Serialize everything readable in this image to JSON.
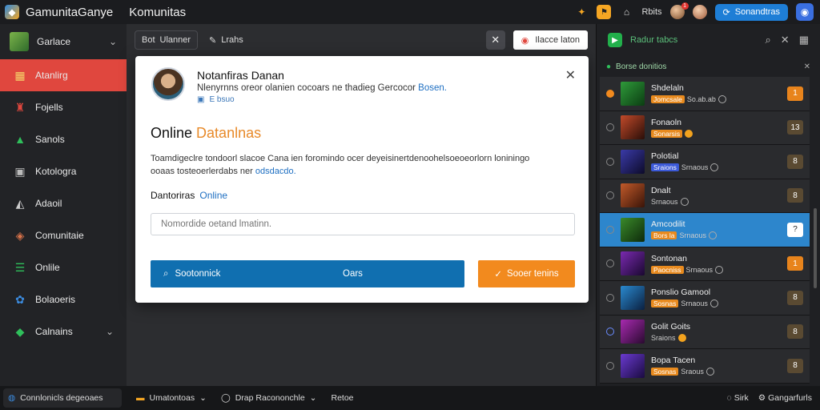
{
  "app": {
    "title": "GamunitaGanye",
    "subtitle": "Komunitas",
    "top_label": "Rbits",
    "notif_count": "1",
    "action_button": "Sonandtras"
  },
  "sidebar": {
    "header_label": "Garlace",
    "items": [
      {
        "label": "Atanlirg",
        "icon": "chart-icon",
        "color": "#f5a623"
      },
      {
        "label": "Fojells",
        "icon": "fire-icon",
        "color": "#e0473e"
      },
      {
        "label": "Sanols",
        "icon": "growth-icon",
        "color": "#2fbf5b"
      },
      {
        "label": "Kotologra",
        "icon": "box-icon",
        "color": "#bbbbbb"
      },
      {
        "label": "Adaoil",
        "icon": "pyramid-icon",
        "color": "#cccccc"
      },
      {
        "label": "Comunitaie",
        "icon": "community-icon",
        "color": "#d9734a"
      },
      {
        "label": "Onlile",
        "icon": "list-icon",
        "color": "#2fbf5b"
      },
      {
        "label": "Bolaoeris",
        "icon": "gear-icon",
        "color": "#3c8ce0"
      },
      {
        "label": "Calnains",
        "icon": "ticket-icon",
        "color": "#2fbf5b"
      }
    ]
  },
  "toolbar": {
    "btn1_label": "Ulanner",
    "btn1_prefix": "Bot",
    "btn2_label": "Lrahs",
    "right_button": "Ilacce laton"
  },
  "modal": {
    "name": "Notanfiras Danan",
    "description": "Nlenyrnns oreor olanien cocoars ne thadieg Gercocor",
    "description_link": "Bosen.",
    "meta": "E bsuo",
    "heading": "Online",
    "heading_accent": "Datanlnas",
    "paragraph": "Toamdigeclre tondoorl slacoe Cana ien foromindo ocer deyeisinertdenoohelsoeoeorlorn loniningo",
    "paragraph_line2": "ooaas tosteoerlerdabs ner",
    "paragraph_link": "odsdacdo.",
    "label": "Dantoriras",
    "label_value": "Online",
    "input_placeholder": "Nomordide oetand lmatinn.",
    "primary_button": "Sootonnick",
    "primary_button_mid": "Oars",
    "secondary_button": "Sooer tenins"
  },
  "rightpanel": {
    "title": "Radur tabcs",
    "subtitle": "Borse donitios",
    "items": [
      {
        "name": "Shdelaln",
        "meta": "So.ab.ab",
        "tag": "Jomcsale",
        "badge": "1",
        "badge_style": "orange",
        "radio": "on",
        "thumb": [
          "#2f9a3a",
          "#0b3d12"
        ]
      },
      {
        "name": "Fonaoln",
        "meta": "",
        "tag": "Sonarsis",
        "badge": "13",
        "badge_style": "brown",
        "radio": "off",
        "thumb": [
          "#c24a2a",
          "#2a0e08"
        ]
      },
      {
        "name": "Polotial",
        "meta": "Srnaous",
        "tag": "Sraions",
        "badge": "8",
        "badge_style": "brown",
        "radio": "off",
        "thumb": [
          "#3a3aa8",
          "#0d0b2a"
        ]
      },
      {
        "name": "Dnalt",
        "meta": "Srnaous",
        "tag": "",
        "badge": "8",
        "badge_style": "brown",
        "radio": "off",
        "thumb": [
          "#c25a2a",
          "#3a1408"
        ]
      },
      {
        "name": "Amcodilit",
        "meta": "Srnaous",
        "tag": "Bors la",
        "badge": "?",
        "badge_style": "white",
        "radio": "off",
        "thumb": [
          "#3a8a2a",
          "#0e2a0b"
        ]
      },
      {
        "name": "Sontonan",
        "meta": "Srnaous",
        "tag": "Paocniss",
        "badge": "1",
        "badge_style": "orange",
        "radio": "off",
        "thumb": [
          "#7a2ab0",
          "#1a0830"
        ]
      },
      {
        "name": "Ponslio Gamool",
        "meta": "Srnaous",
        "tag": "Sosnas",
        "badge": "8",
        "badge_style": "brown",
        "radio": "off",
        "thumb": [
          "#2a8ad0",
          "#0b2040"
        ]
      },
      {
        "name": "Golit Goits",
        "meta": "Sraions",
        "tag": "",
        "badge": "8",
        "badge_style": "brown",
        "radio": "blue",
        "thumb": [
          "#a82ab0",
          "#2a0a30"
        ]
      },
      {
        "name": "Bopa Tacen",
        "meta": "Sraous",
        "tag": "Sosnas",
        "badge": "8",
        "badge_style": "brown",
        "radio": "off",
        "thumb": [
          "#6a3ad0",
          "#1a0b40"
        ]
      }
    ]
  },
  "bottombar": {
    "left_label": "Connlonicls degeoaes",
    "seg1": "Umatontoas",
    "seg2": "Drap Racononchle",
    "seg3": "Retoe",
    "right1": "Sirk",
    "right2": "Gangarfurls"
  }
}
